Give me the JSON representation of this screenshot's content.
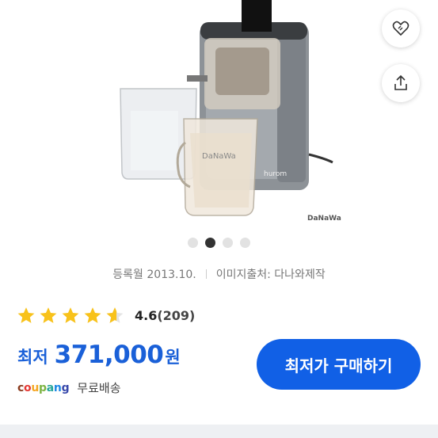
{
  "gallery": {
    "watermark": "DaNaWa",
    "product_brand": "Hurom",
    "dots_total": 4,
    "dots_active": 2
  },
  "actions": {
    "wish_icon": "heart-tag-icon",
    "share_icon": "share-icon"
  },
  "meta": {
    "registered": "등록월 2013.10.",
    "image_source": "이미지출처: 다나와제작"
  },
  "rating": {
    "score": "4.6",
    "count": "(209)",
    "stars_value": 4.6,
    "star_color": "#f8c21b"
  },
  "price": {
    "prefix": "최저",
    "value": "371,000",
    "unit": "원",
    "color": "#1a60d8"
  },
  "seller": {
    "logo": "coupang",
    "shipping": "무료배송"
  },
  "buy_button": {
    "label": "최저가 구매하기",
    "color": "#1160e6"
  }
}
